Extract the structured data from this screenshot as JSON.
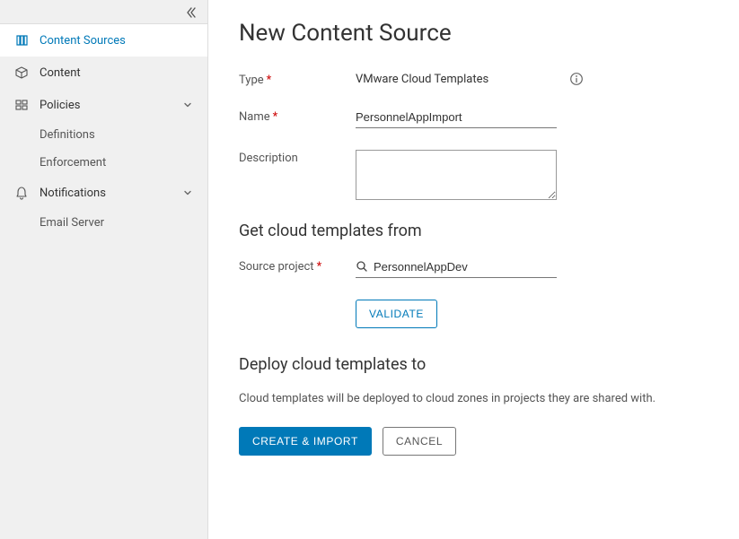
{
  "sidebar": {
    "items": [
      {
        "label": "Content Sources"
      },
      {
        "label": "Content"
      },
      {
        "label": "Policies"
      },
      {
        "label": "Definitions"
      },
      {
        "label": "Enforcement"
      },
      {
        "label": "Notifications"
      },
      {
        "label": "Email Server"
      }
    ]
  },
  "page": {
    "title": "New Content Source",
    "type_label": "Type",
    "type_value": "VMware Cloud Templates",
    "name_label": "Name",
    "name_value": "PersonnelAppImport",
    "desc_label": "Description",
    "desc_value": "",
    "section_from": "Get cloud templates from",
    "source_project_label": "Source project",
    "source_project_value": "PersonnelAppDev",
    "validate_label": "VALIDATE",
    "section_to": "Deploy cloud templates to",
    "deploy_text": "Cloud templates will be deployed to cloud zones in projects they are shared with.",
    "create_label": "CREATE & IMPORT",
    "cancel_label": "CANCEL"
  }
}
